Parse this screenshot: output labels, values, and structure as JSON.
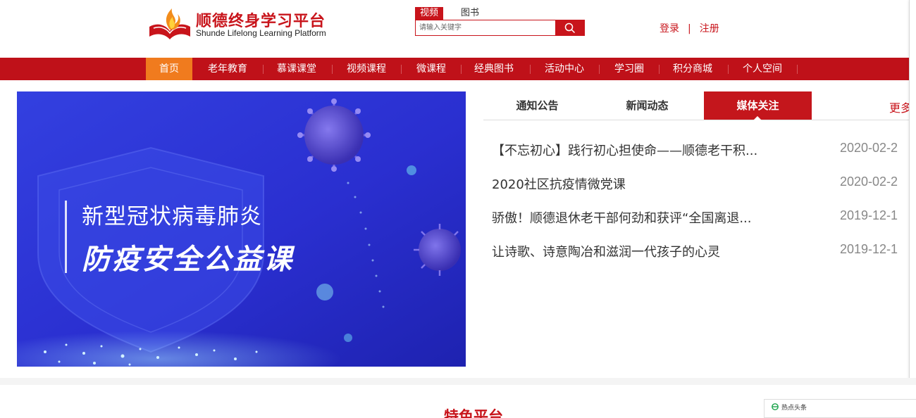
{
  "header": {
    "logo_title": "顺德终身学习平台",
    "logo_subtitle": "Shunde Lifelong Learning Platform",
    "search_tabs": [
      "视频",
      "图书"
    ],
    "search_placeholder": "请输入关键字",
    "login": "登录",
    "separator": "|",
    "register": "注册"
  },
  "nav": {
    "items": [
      "首页",
      "老年教育",
      "慕课课堂",
      "视频课程",
      "微课程",
      "经典图书",
      "活动中心",
      "学习圈",
      "积分商城",
      "个人空间"
    ],
    "active_index": 0
  },
  "banner": {
    "line1": "新型冠状病毒肺炎",
    "line2": "防疫安全公益课"
  },
  "news": {
    "tabs": [
      "通知公告",
      "新闻动态",
      "媒体关注"
    ],
    "active_tab": 2,
    "more": "更多",
    "items": [
      {
        "title": "【不忘初心】践行初心担使命——顺德老干积...",
        "date": "2020-02-2"
      },
      {
        "title": "2020社区抗疫情微党课",
        "date": "2020-02-2"
      },
      {
        "title": "骄傲！顺德退休老干部何劲和获评“全国离退...",
        "date": "2019-12-1"
      },
      {
        "title": "让诗歌、诗意陶冶和滋润一代孩子的心灵",
        "date": "2019-12-1"
      }
    ]
  },
  "section": {
    "title": "特色平台"
  },
  "hot_box": {
    "label": "热点头条"
  },
  "colors": {
    "brand_red": "#c8141b",
    "nav_red": "#bf1119",
    "nav_active": "#f07b1e",
    "banner_blue": "#2a35d6"
  }
}
